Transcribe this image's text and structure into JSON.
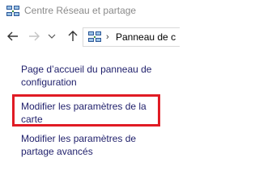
{
  "window": {
    "title": "Centre Réseau et partage",
    "icon": "network-center-icon"
  },
  "navigation": {
    "back_icon": "arrow-left-icon",
    "forward_icon": "arrow-right-icon",
    "recent_icon": "chevron-down-icon",
    "up_icon": "arrow-up-icon",
    "address": {
      "icon": "network-center-icon",
      "separator": "›",
      "path": "Panneau de c"
    }
  },
  "task_pane": {
    "links": [
      {
        "label": "Page d’accueil du panneau de configuration"
      },
      {
        "label": "Modifier les paramètres de la carte",
        "highlighted": true
      },
      {
        "label": "Modifier les paramètres de partage avancés"
      }
    ]
  },
  "colors": {
    "link": "#1f1f6b",
    "highlight": "#e01b24",
    "title": "#8a8a8a"
  }
}
